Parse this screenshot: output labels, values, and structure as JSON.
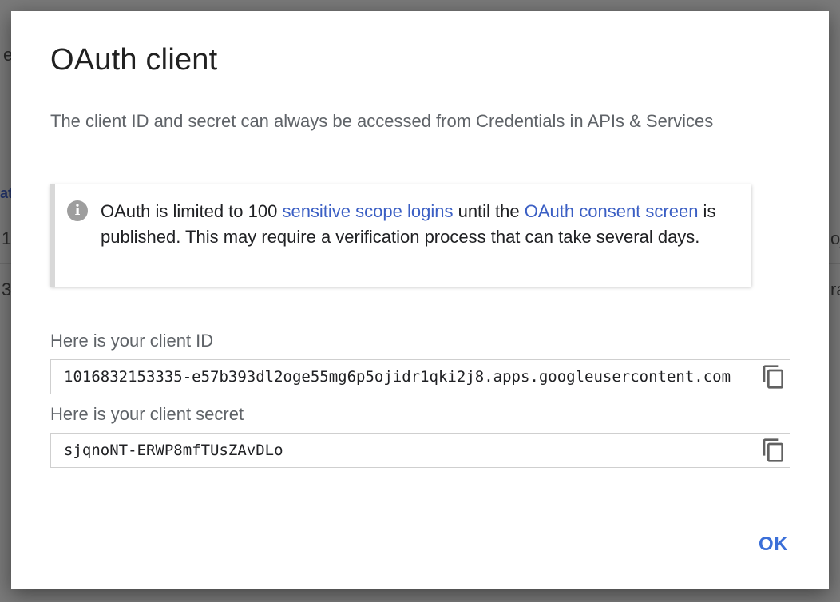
{
  "background": {
    "fragments": [
      "e",
      "ati",
      "1",
      "3",
      "oj",
      "ra"
    ]
  },
  "dialog": {
    "title": "OAuth client",
    "subtitle": "The client ID and secret can always be accessed from Credentials in APIs & Services",
    "notice": {
      "icon": "info-icon",
      "text_before": "OAuth is limited to 100 ",
      "link1": "sensitive scope logins",
      "text_middle": " until the ",
      "link2": "OAuth consent screen",
      "text_after": " is published. This may require a verification process that can take several days."
    },
    "client_id": {
      "label": "Here is your client ID",
      "value": "1016832153335-e57b393dl2oge55mg6p5ojidr1qki2j8.apps.googleusercontent.com",
      "copy_icon": "copy-icon"
    },
    "client_secret": {
      "label": "Here is your client secret",
      "value": "sjqnoNT-ERWP8mfTUsZAvDLo",
      "copy_icon": "copy-icon"
    },
    "ok_label": "OK"
  },
  "colors": {
    "link": "#3b5fc4",
    "ok_button": "#3b6fd8",
    "notice_border": "#d8d8d8"
  }
}
